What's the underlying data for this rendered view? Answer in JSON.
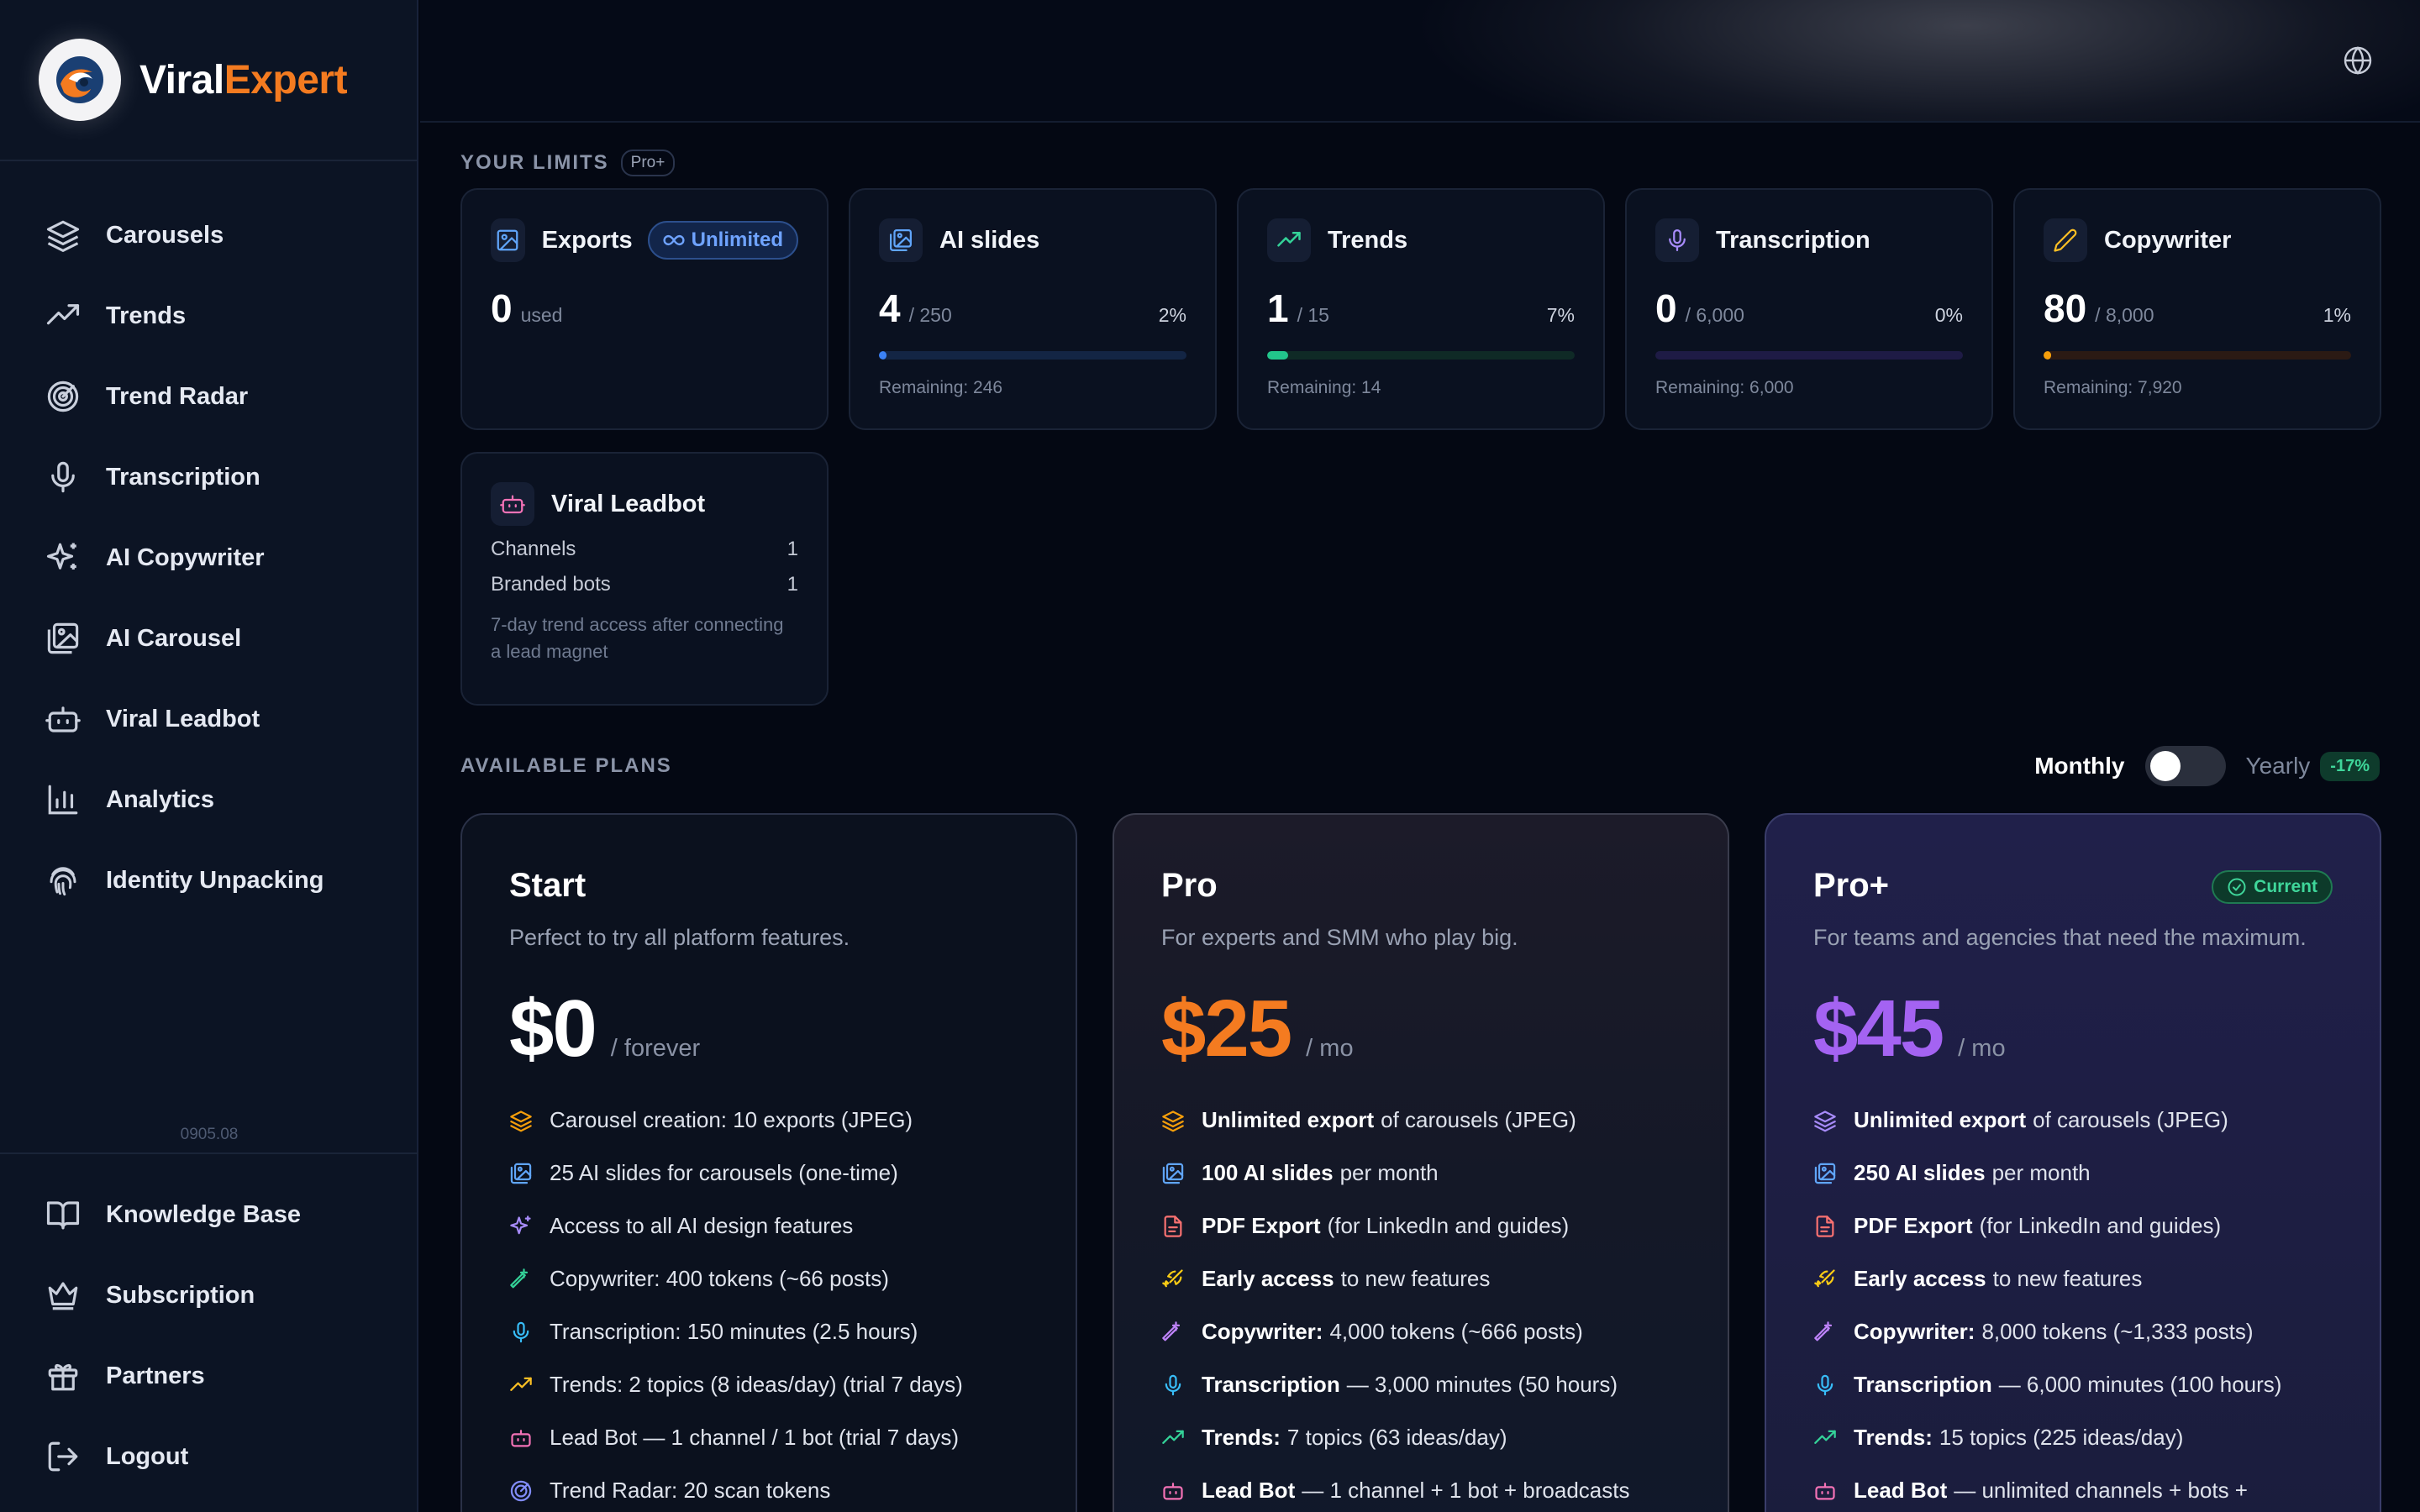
{
  "brand": {
    "name_part1": "Viral",
    "name_part2": "Expert",
    "accent": "#f47b20"
  },
  "sidebar": {
    "items": [
      {
        "label": "Carousels",
        "icon": "layers-icon"
      },
      {
        "label": "Trends",
        "icon": "trending-up-icon"
      },
      {
        "label": "Trend Radar",
        "icon": "radar-icon"
      },
      {
        "label": "Transcription",
        "icon": "microphone-icon"
      },
      {
        "label": "AI Copywriter",
        "icon": "sparkles-icon"
      },
      {
        "label": "AI Carousel",
        "icon": "image-stack-icon"
      },
      {
        "label": "Viral Leadbot",
        "icon": "bot-icon"
      },
      {
        "label": "Analytics",
        "icon": "bar-chart-icon"
      },
      {
        "label": "Identity Unpacking",
        "icon": "fingerprint-icon"
      }
    ],
    "version": "0905.08",
    "bottom_items": [
      {
        "label": "Knowledge Base",
        "icon": "book-icon"
      },
      {
        "label": "Subscription",
        "icon": "crown-icon"
      },
      {
        "label": "Partners",
        "icon": "gift-icon"
      },
      {
        "label": "Logout",
        "icon": "logout-icon"
      }
    ]
  },
  "limits": {
    "label": "YOUR LIMITS",
    "plan_pill": "Pro+",
    "exports": {
      "title": "Exports",
      "badge": "Unlimited",
      "value": "0",
      "unit": "used"
    },
    "cards": [
      {
        "title": "AI slides",
        "value": "4",
        "max": "/ 250",
        "pct": "2%",
        "fraction": 0.016,
        "remaining": "Remaining: 246",
        "color": "#3b82f6",
        "track": "#132544"
      },
      {
        "title": "Trends",
        "value": "1",
        "max": "/ 15",
        "pct": "7%",
        "fraction": 0.067,
        "remaining": "Remaining: 14",
        "color": "#22c58b",
        "track": "#0f2a26"
      },
      {
        "title": "Transcription",
        "value": "0",
        "max": "/ 6,000",
        "pct": "0%",
        "fraction": 0.0,
        "remaining": "Remaining: 6,000",
        "color": "#8b5cf6",
        "track": "#1e1b45"
      },
      {
        "title": "Copywriter",
        "value": "80",
        "max": "/ 8,000",
        "pct": "1%",
        "fraction": 0.01,
        "remaining": "Remaining: 7,920",
        "color": "#f59e0b",
        "track": "#2b1a14"
      }
    ],
    "leadbot": {
      "title": "Viral Leadbot",
      "rows": [
        {
          "label": "Channels",
          "value": "1"
        },
        {
          "label": "Branded bots",
          "value": "1"
        }
      ],
      "note": "7-day trend access after connecting a lead magnet"
    }
  },
  "plans_section": {
    "label": "AVAILABLE PLANS",
    "toggle_monthly": "Monthly",
    "toggle_yearly": "Yearly",
    "discount": "-17%"
  },
  "plans": [
    {
      "name": "Start",
      "desc": "Perfect to try all platform features.",
      "price": "$0",
      "period": "/ forever",
      "price_color": "#ffffff",
      "features": [
        {
          "bold": "",
          "text": "Carousel creation: 10 exports (JPEG)"
        },
        {
          "bold": "",
          "text": "25 AI slides for carousels (one-time)"
        },
        {
          "bold": "",
          "text": "Access to all AI design features"
        },
        {
          "bold": "",
          "text": "Copywriter: 400 tokens (~66 posts)"
        },
        {
          "bold": "",
          "text": "Transcription: 150 minutes (2.5 hours)"
        },
        {
          "bold": "",
          "text": "Trends: 2 topics (8 ideas/day) (trial 7 days)"
        },
        {
          "bold": "",
          "text": "Lead Bot — 1 channel / 1 bot (trial 7 days)"
        },
        {
          "bold": "",
          "text": "Trend Radar: 20 scan tokens"
        }
      ]
    },
    {
      "name": "Pro",
      "desc": "For experts and SMM who play big.",
      "price": "$25",
      "period": "/ mo",
      "price_color": "#f47b20",
      "features": [
        {
          "bold": "Unlimited export",
          "text": "of carousels (JPEG)"
        },
        {
          "bold": "100 AI slides",
          "text": "per month"
        },
        {
          "bold": "PDF Export",
          "text": "(for LinkedIn and guides)"
        },
        {
          "bold": "Early access",
          "text": "to new features"
        },
        {
          "bold": "Copywriter:",
          "text": "4,000 tokens (~666 posts)"
        },
        {
          "bold": "Transcription",
          "text": "— 3,000 minutes (50 hours)"
        },
        {
          "bold": "Trends:",
          "text": "7 topics (63 ideas/day)"
        },
        {
          "bold": "Lead Bot",
          "text": "— 1 channel + 1 bot + broadcasts"
        }
      ]
    },
    {
      "name": "Pro+",
      "desc": "For teams and agencies that need the maximum.",
      "price": "$45",
      "period": "/ mo",
      "price_color": "#a463f2",
      "current": "Current",
      "features": [
        {
          "bold": "Unlimited export",
          "text": "of carousels (JPEG)"
        },
        {
          "bold": "250 AI slides",
          "text": "per month"
        },
        {
          "bold": "PDF Export",
          "text": "(for LinkedIn and guides)"
        },
        {
          "bold": "Early access",
          "text": "to new features"
        },
        {
          "bold": "Copywriter:",
          "text": "8,000 tokens (~1,333 posts)"
        },
        {
          "bold": "Transcription",
          "text": "— 6,000 minutes (100 hours)"
        },
        {
          "bold": "Trends:",
          "text": "15 topics (225 ideas/day)"
        },
        {
          "bold": "Lead Bot",
          "text": "— unlimited channels + bots +"
        }
      ]
    }
  ]
}
